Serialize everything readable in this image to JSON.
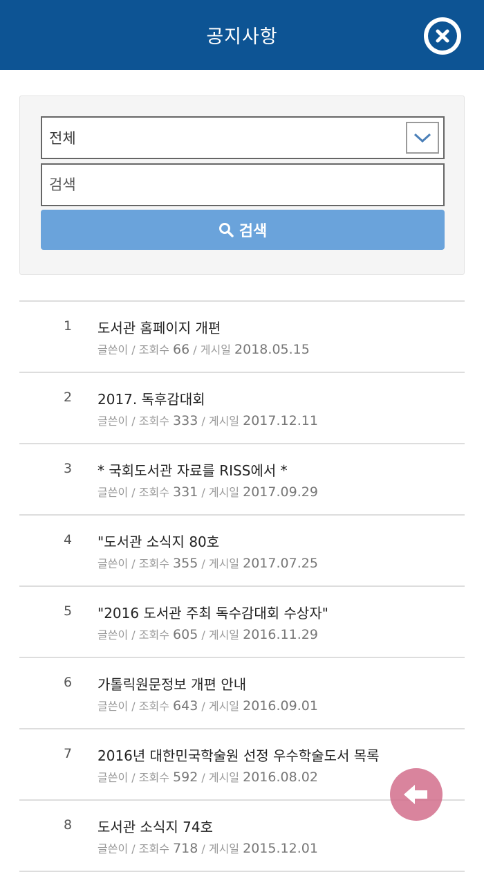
{
  "header": {
    "title": "공지사항",
    "close_icon": "close-circle-icon"
  },
  "search": {
    "category_value": "전체",
    "query_placeholder": "검색",
    "button_label": "검색",
    "button_icon": "search-icon"
  },
  "meta_labels": {
    "author": "글쓴이",
    "views": "조회수",
    "posted": "게시일",
    "sep": "/"
  },
  "notices": [
    {
      "num": "1",
      "title": "도서관 홈페이지 개편",
      "views": "66",
      "date": "2018.05.15"
    },
    {
      "num": "2",
      "title": "2017. 독후감대회",
      "views": "333",
      "date": "2017.12.11"
    },
    {
      "num": "3",
      "title": "* 국회도서관 자료를 RISS에서 *",
      "views": "331",
      "date": "2017.09.29"
    },
    {
      "num": "4",
      "title": "\"도서관 소식지 80호",
      "views": "355",
      "date": "2017.07.25"
    },
    {
      "num": "5",
      "title": "\"2016 도서관 주최 독수감대회 수상자\"",
      "views": "605",
      "date": "2016.11.29"
    },
    {
      "num": "6",
      "title": "가톨릭원문정보 개편 안내",
      "views": "643",
      "date": "2016.09.01"
    },
    {
      "num": "7",
      "title": "2016년 대한민국학술원 선정 우수학술도서 목록",
      "views": "592",
      "date": "2016.08.02"
    },
    {
      "num": "8",
      "title": "도서관 소식지 74호",
      "views": "718",
      "date": "2015.12.01"
    }
  ],
  "fab": {
    "icon": "back-arrow-icon"
  },
  "colors": {
    "header_bg": "#0d5494",
    "search_button": "#6aa3db",
    "fab": "#d26e8c"
  }
}
